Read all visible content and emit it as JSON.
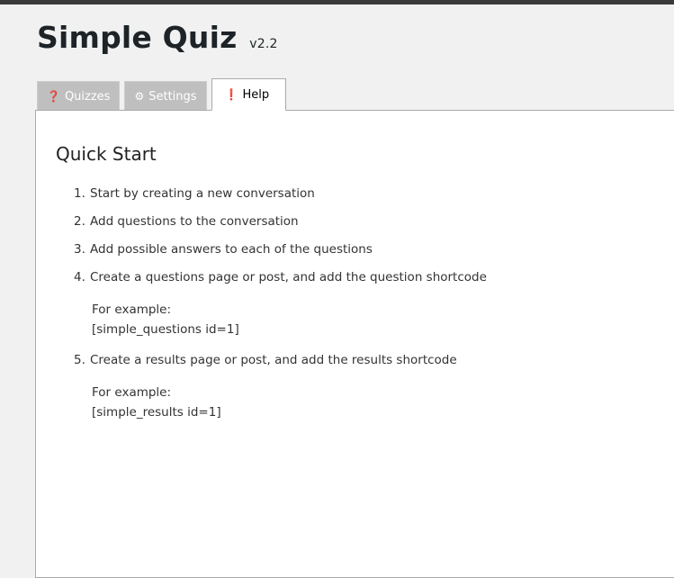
{
  "header": {
    "title": "Simple Quiz",
    "version": "v2.2"
  },
  "tabs": [
    {
      "icon": "question-circle-icon",
      "glyph": "❓",
      "label": "Quizzes",
      "active": false
    },
    {
      "icon": "gears-icon",
      "glyph": "⚙",
      "label": "Settings",
      "active": false
    },
    {
      "icon": "exclamation-circle-icon",
      "glyph": "❗",
      "label": "Help",
      "active": true
    }
  ],
  "help": {
    "heading": "Quick Start",
    "steps": [
      {
        "num": "1.",
        "text": "Start by creating a new conversation"
      },
      {
        "num": "2.",
        "text": "Add questions to the conversation"
      },
      {
        "num": "3.",
        "text": "Add possible answers to each of the questions"
      },
      {
        "num": "4.",
        "text": "Create a questions page or post, and add the question shortcode"
      },
      {
        "num": "5.",
        "text": "Create a results page or post, and add the results shortcode"
      }
    ],
    "example_questions": {
      "label": "For example:",
      "code": "[simple_questions id=1]"
    },
    "example_results": {
      "label": "For example:",
      "code": "[simple_results id=1]"
    }
  },
  "colors": {
    "active_tab_bg": "#ffffff",
    "inactive_tab_bg": "#bfbfbf",
    "page_bg": "#f1f1f1"
  }
}
